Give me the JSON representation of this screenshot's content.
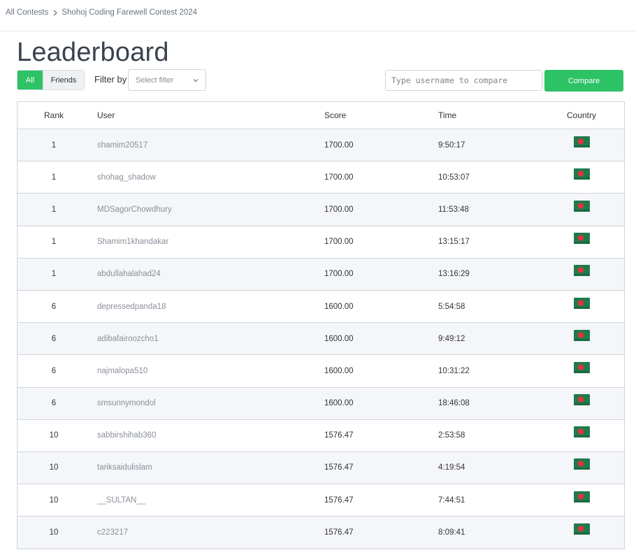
{
  "breadcrumb": {
    "parent": "All Contests",
    "current": "Shohoj Coding Farewell Contest 2024"
  },
  "page": {
    "title": "Leaderboard"
  },
  "tabs": {
    "all": "All",
    "friends": "Friends",
    "active": "All"
  },
  "filter": {
    "label": "Filter by",
    "selected": "Select filter"
  },
  "compare": {
    "placeholder": "Type username to compare",
    "value": "",
    "button": "Compare"
  },
  "table": {
    "headers": {
      "rank": "Rank",
      "user": "User",
      "score": "Score",
      "time": "Time",
      "country": "Country"
    },
    "rows": [
      {
        "rank": "1",
        "user": "shamim20517",
        "score": "1700.00",
        "time": "9:50:17",
        "country": "bangladesh-flag-icon"
      },
      {
        "rank": "1",
        "user": "shohag_shadow",
        "score": "1700.00",
        "time": "10:53:07",
        "country": "bangladesh-flag-icon"
      },
      {
        "rank": "1",
        "user": "MDSagorChowdhury",
        "score": "1700.00",
        "time": "11:53:48",
        "country": "bangladesh-flag-icon"
      },
      {
        "rank": "1",
        "user": "Shamim1khandakar",
        "score": "1700.00",
        "time": "13:15:17",
        "country": "bangladesh-flag-icon"
      },
      {
        "rank": "1",
        "user": "abdullahalahad24",
        "score": "1700.00",
        "time": "13:16:29",
        "country": "bangladesh-flag-icon"
      },
      {
        "rank": "6",
        "user": "depressedpanda18",
        "score": "1600.00",
        "time": "5:54:58",
        "country": "bangladesh-flag-icon"
      },
      {
        "rank": "6",
        "user": "adibafairoozcho1",
        "score": "1600.00",
        "time": "9:49:12",
        "country": "bangladesh-flag-icon"
      },
      {
        "rank": "6",
        "user": "najmalopa510",
        "score": "1600.00",
        "time": "10:31:22",
        "country": "bangladesh-flag-icon"
      },
      {
        "rank": "6",
        "user": "smsunnymondol",
        "score": "1600.00",
        "time": "18:46:08",
        "country": "bangladesh-flag-icon"
      },
      {
        "rank": "10",
        "user": "sabbirshihab360",
        "score": "1576.47",
        "time": "2:53:58",
        "country": "bangladesh-flag-icon"
      },
      {
        "rank": "10",
        "user": "tariksaidulislam",
        "score": "1576.47",
        "time": "4:19:54",
        "country": "bangladesh-flag-icon"
      },
      {
        "rank": "10",
        "user": "__SULTAN__",
        "score": "1576.47",
        "time": "7:44:51",
        "country": "bangladesh-flag-icon"
      },
      {
        "rank": "10",
        "user": "c223217",
        "score": "1576.47",
        "time": "8:09:41",
        "country": "bangladesh-flag-icon"
      }
    ]
  },
  "colors": {
    "accent_green": "#2cc265",
    "flag_green": "#1f7a4c",
    "flag_red": "#e2343a",
    "title_text": "#39434f",
    "link_text": "#8a9099"
  }
}
